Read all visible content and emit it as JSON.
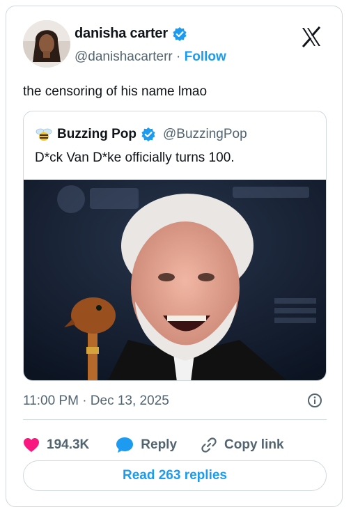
{
  "author": {
    "name": "danisha carter",
    "handle": "@danishacarterr",
    "separator": "·",
    "follow_label": "Follow"
  },
  "tweet": {
    "text": "the censoring of his name lmao",
    "timestamp": "11:00 PM · Dec 13, 2025"
  },
  "quoted": {
    "name": "Buzzing Pop",
    "handle": "@BuzzingPop",
    "text": "D*ck Van D*ke officially turns 100."
  },
  "actions": {
    "likes": "194.3K",
    "reply_label": "Reply",
    "copy_link_label": "Copy link"
  },
  "read_replies_label": "Read 263 replies",
  "colors": {
    "accent": "#1d9bf0",
    "like": "#f91880",
    "muted": "#536471",
    "border": "#cfd9de"
  },
  "icons": [
    "verified-badge-icon",
    "x-logo-icon",
    "bee-icon",
    "heart-icon",
    "reply-bubble-icon",
    "link-icon",
    "info-icon"
  ]
}
